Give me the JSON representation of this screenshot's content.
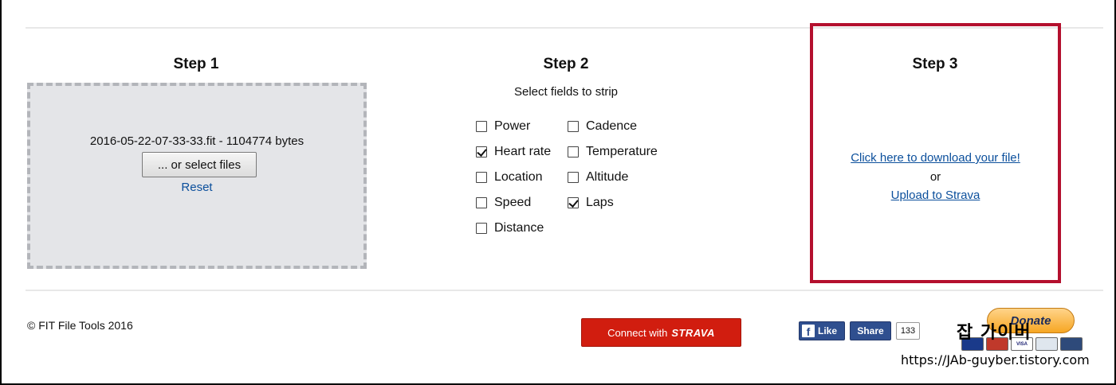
{
  "step1": {
    "title": "Step 1",
    "filename": "2016-05-22-07-33-33.fit - 1104774 bytes",
    "select_button": "... or select files",
    "reset_link": "Reset"
  },
  "step2": {
    "title": "Step 2",
    "subtitle": "Select fields to strip",
    "fields": [
      {
        "label": "Power",
        "checked": false
      },
      {
        "label": "Heart rate",
        "checked": true
      },
      {
        "label": "Location",
        "checked": false
      },
      {
        "label": "Speed",
        "checked": false
      },
      {
        "label": "Distance",
        "checked": false
      },
      {
        "label": "Cadence",
        "checked": false
      },
      {
        "label": "Temperature",
        "checked": false
      },
      {
        "label": "Altitude",
        "checked": false
      },
      {
        "label": "Laps",
        "checked": true
      }
    ]
  },
  "step3": {
    "title": "Step 3",
    "download_link": "Click here to download your file!",
    "or_text": "or",
    "strava_link": "Upload to Strava",
    "highlight_color": "#b4102e"
  },
  "footer": {
    "copyright": "© FIT File Tools 2016",
    "connect_label": "Connect with",
    "connect_brand": "STRAVA",
    "fb_like": "Like",
    "fb_share": "Share",
    "share_count": "133",
    "donate": "Donate",
    "cards": [
      "mastercard-icon",
      "maestro-icon",
      "visa-icon",
      "amex-icon",
      "discover-icon"
    ]
  },
  "watermark": {
    "title": "잡 가이버",
    "url": "https://JAb-guyber.tistory.com"
  },
  "colors": {
    "link": "#0b4f9c",
    "strava_red": "#d11d0f",
    "facebook_blue": "#2f4f8f",
    "donate_orange": "#f6a623"
  }
}
